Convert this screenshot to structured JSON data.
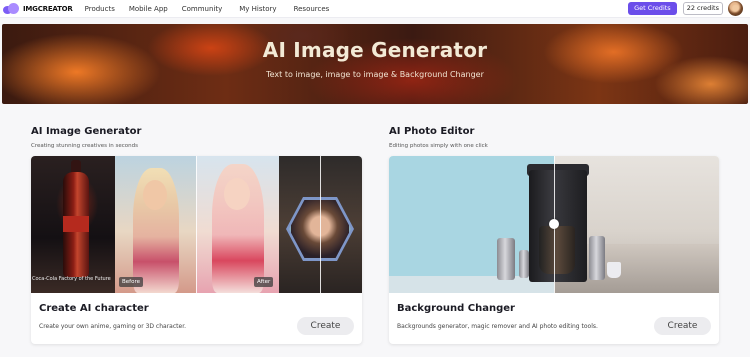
{
  "nav": {
    "logo_text": "IMGCREATOR",
    "links": [
      "Products",
      "Mobile App",
      "Community",
      "My History",
      "Resources"
    ],
    "get_credits_label": "Get Credits",
    "credits_label": "22 credits"
  },
  "hero": {
    "title": "AI Image Generator",
    "subtitle": "Text to image, image to image & Background Changer"
  },
  "sections": [
    {
      "title": "AI Image Generator",
      "subtitle": "Creating stunning creatives in seconds",
      "card": {
        "title": "Create AI character",
        "description": "Create your own anime, gaming or 3D character.",
        "button_label": "Create",
        "before_tag": "Before",
        "after_tag": "After",
        "watermark": "Coca-Cola Factory of the Future"
      }
    },
    {
      "title": "AI Photo Editor",
      "subtitle": "Editing photos simply with one click",
      "card": {
        "title": "Background Changer",
        "description": "Backgrounds generator, magic remover and AI photo editing tools.",
        "button_label": "Create"
      }
    }
  ],
  "colors": {
    "accent": "#6b4eea",
    "hero_text": "#f3ead6"
  }
}
